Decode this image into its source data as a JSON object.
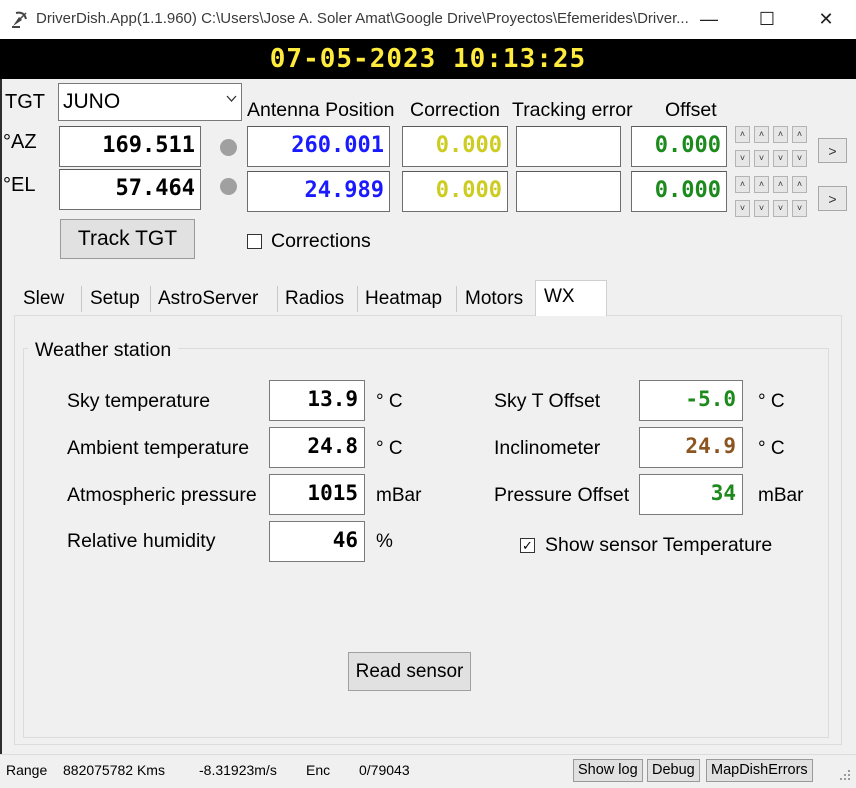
{
  "window": {
    "title": "DriverDish.App(1.1.960) C:\\Users\\Jose A. Soler Amat\\Google Drive\\Proyectos\\Efemerides\\Driver...",
    "minimize": "—",
    "maximize": "☐",
    "close": "✕"
  },
  "clock": "07-05-2023 10:13:25",
  "target": {
    "label": "TGT",
    "value": "JUNO",
    "dropdown_icon": "chevron-down-icon"
  },
  "headers": {
    "antenna_position": "Antenna Position",
    "correction": "Correction",
    "tracking_error": "Tracking error",
    "offset": "Offset"
  },
  "axes": [
    {
      "label": "°AZ",
      "target_value": "169.511",
      "antenna_position": "260.001",
      "correction": "0.000",
      "tracking_error": "",
      "offset": "0.000"
    },
    {
      "label": "°EL",
      "target_value": "57.464",
      "antenna_position": "24.989",
      "correction": "0.000",
      "tracking_error": "",
      "offset": "0.000"
    }
  ],
  "step_buttons": {
    "up": "˄",
    "down": "˅",
    "go": ">"
  },
  "track_button": "Track TGT",
  "corrections_checkbox": {
    "label": "Corrections",
    "checked": false
  },
  "tabs": [
    "Slew",
    "Setup",
    "AstroServer",
    "Radios",
    "Heatmap",
    "Motors",
    "WX"
  ],
  "active_tab": "WX",
  "weather": {
    "title": "Weather station",
    "sky_temperature": {
      "label": "Sky temperature",
      "value": "13.9",
      "unit": "° C"
    },
    "ambient_temperature": {
      "label": "Ambient temperature",
      "value": "24.8",
      "unit": "° C"
    },
    "atmospheric_pressure": {
      "label": "Atmospheric pressure",
      "value": "1015",
      "unit": "mBar"
    },
    "relative_humidity": {
      "label": "Relative humidity",
      "value": "46",
      "unit": "%"
    },
    "sky_t_offset": {
      "label": "Sky T Offset",
      "value": "-5.0",
      "unit": "° C"
    },
    "inclinometer": {
      "label": "Inclinometer",
      "value": "24.9",
      "unit": "° C"
    },
    "pressure_offset": {
      "label": "Pressure Offset",
      "value": "34",
      "unit": "mBar"
    },
    "show_sensor_temperature": {
      "label": "Show sensor Temperature",
      "checked": true
    },
    "read_button": "Read sensor"
  },
  "status": {
    "range_label": "Range",
    "range_value": "882075782 Kms",
    "rate": "-8.31923m/s",
    "enc_label": "Enc",
    "enc_value": "0/79043",
    "show_log": "Show log",
    "debug": "Debug",
    "map_dish_errors": "MapDishErrors"
  },
  "colors": {
    "clock_text": "#ffeb3b",
    "antenna_position": "#1a1aff",
    "correction": "#cccc22",
    "offset": "#1c8a1c",
    "inclinometer": "#8a5520"
  }
}
